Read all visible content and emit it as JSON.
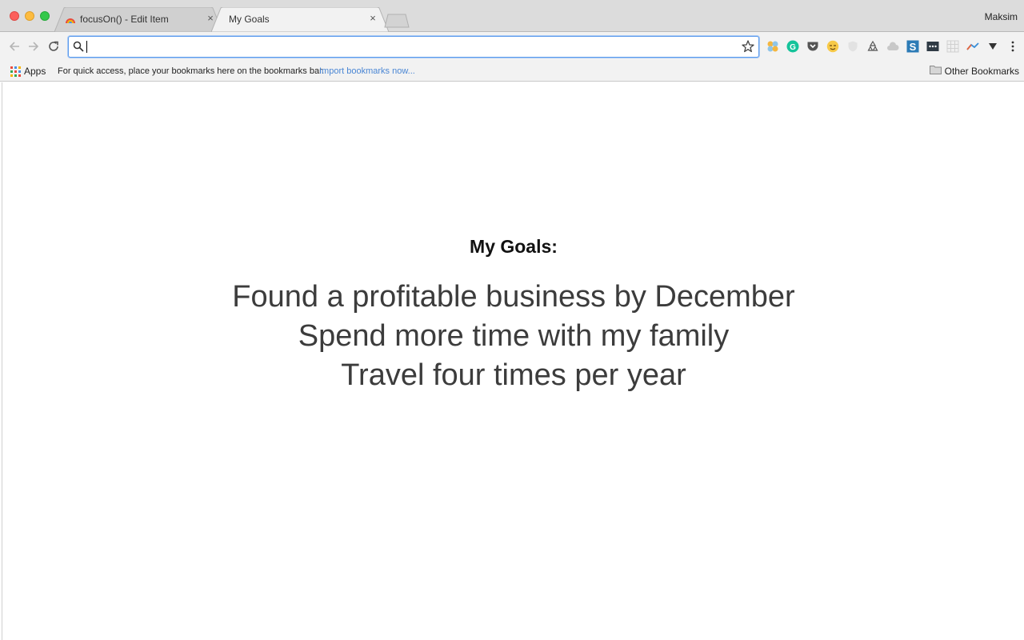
{
  "browser": {
    "profile_name": "Maksim",
    "tabs": [
      {
        "title": "focusOn() - Edit Item",
        "active": false
      },
      {
        "title": "My Goals",
        "active": true
      }
    ],
    "close_glyph": "×",
    "omnibox": {
      "value": "",
      "placeholder": ""
    },
    "extensions": [
      "puzzle-flower-icon",
      "grammarly-icon",
      "pocket-icon",
      "emoji-icon",
      "shield-icon",
      "recycle-icon",
      "cloud-icon",
      "s-app-icon",
      "dots-app-icon",
      "grid-app-icon",
      "chart-app-icon",
      "dropdown-icon",
      "menu-icon"
    ]
  },
  "bookmarks_bar": {
    "apps_label": "Apps",
    "hint": "For quick access, place your bookmarks here on the bookmarks bar.",
    "import_link": "Import bookmarks now...",
    "other_bookmarks": "Other Bookmarks"
  },
  "page": {
    "heading": "My Goals:",
    "goals": [
      "Found a profitable business by December",
      "Spend more time with my family",
      "Travel four times per year"
    ]
  },
  "colors": {
    "omnibox_focus": "#5d9cec",
    "link": "#4a86d4",
    "goal_text": "#3c3c3c"
  }
}
